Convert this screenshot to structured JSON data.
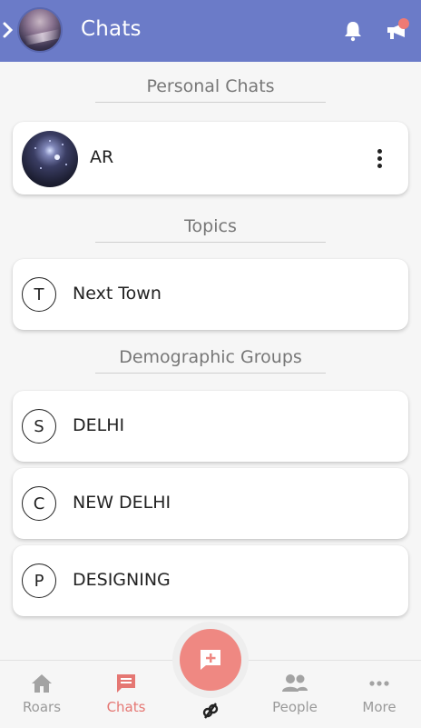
{
  "header": {
    "title": "Chats"
  },
  "sections": {
    "personal": "Personal Chats",
    "topics": "Topics",
    "groups": "Demographic Groups"
  },
  "personal_chats": [
    {
      "name": "AR"
    }
  ],
  "topics": [
    {
      "letter": "T",
      "name": "Next Town"
    }
  ],
  "groups": [
    {
      "letter": "S",
      "name": "DELHI"
    },
    {
      "letter": "C",
      "name": "NEW DELHI"
    },
    {
      "letter": "P",
      "name": "DESIGNING"
    }
  ],
  "nav": {
    "items": [
      {
        "label": "Roars",
        "icon": "home-icon"
      },
      {
        "label": "Chats",
        "icon": "chat-icon",
        "active": true
      },
      {
        "label": "People",
        "icon": "people-icon"
      },
      {
        "label": "More",
        "icon": "more-icon"
      }
    ]
  },
  "colors": {
    "header": "#6b7bc8",
    "accent": "#e57773",
    "fab": "#ef8882"
  }
}
